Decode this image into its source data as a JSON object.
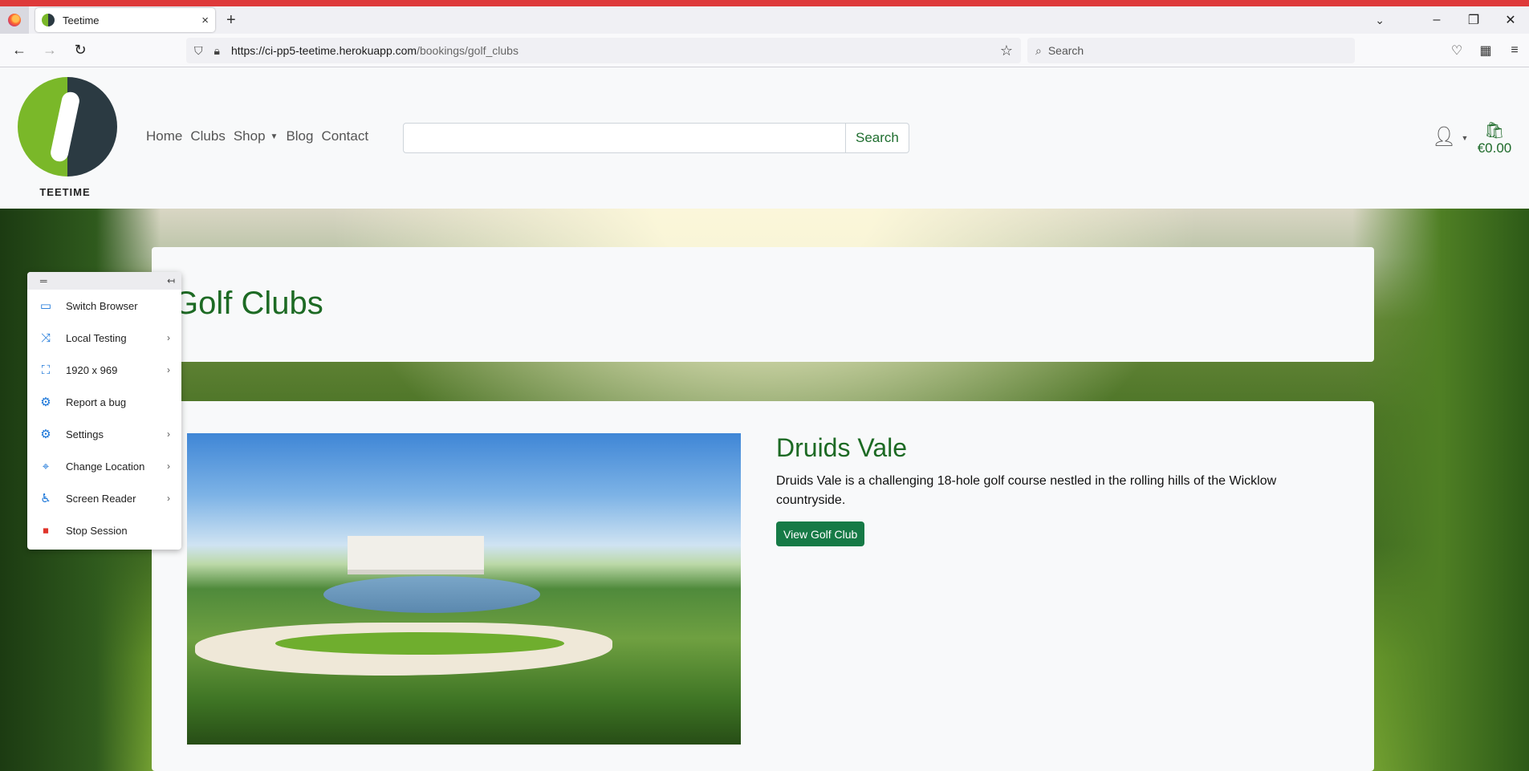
{
  "browser": {
    "tab_title": "Teetime",
    "tab_close": "×",
    "new_tab": "+",
    "url_host": "https://ci-pp5-teetime.herokuapp.com",
    "url_path": "/bookings/golf_clubs",
    "search_placeholder": "Search"
  },
  "site": {
    "logo_text": "TEETIME",
    "nav": [
      "Home",
      "Clubs",
      "Shop",
      "Blog",
      "Contact"
    ],
    "search_button": "Search",
    "basket_total": "€0.00"
  },
  "page": {
    "title": "Golf Clubs"
  },
  "club": {
    "name": "Druids Vale",
    "description": "Druids Vale is a challenging 18-hole golf course nestled in the rolling hills of the Wicklow countryside.",
    "button": "View Golf Club"
  },
  "panel": {
    "items": [
      {
        "label": "Switch Browser",
        "icon": "devices-icon",
        "arrow": false
      },
      {
        "label": "Local Testing",
        "icon": "shuffle-icon",
        "arrow": true
      },
      {
        "label": "1920 x 969",
        "icon": "resolution-icon",
        "arrow": true
      },
      {
        "label": "Report a bug",
        "icon": "bug-icon",
        "arrow": false
      },
      {
        "label": "Settings",
        "icon": "gear-icon",
        "arrow": true
      },
      {
        "label": "Change Location",
        "icon": "location-pin-icon",
        "arrow": true
      },
      {
        "label": "Screen Reader",
        "icon": "accessibility-icon",
        "arrow": true
      },
      {
        "label": "Stop Session",
        "icon": "stop-icon",
        "arrow": false
      }
    ]
  },
  "colors": {
    "accent_green": "#1d6a24",
    "button_green": "#167a46",
    "browser_top_strip": "#de3a3a"
  }
}
